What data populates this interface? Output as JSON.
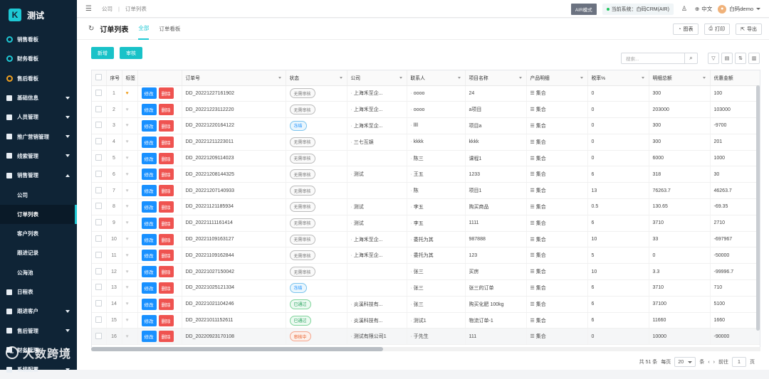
{
  "brand": {
    "logo": "K",
    "name": "测试"
  },
  "sidebar": {
    "items": [
      {
        "label": "销售看板",
        "icon": "ring-icon",
        "color": "teal",
        "arrow": ""
      },
      {
        "label": "财务看板",
        "icon": "ring-icon",
        "color": "teal",
        "arrow": ""
      },
      {
        "label": "售后看板",
        "icon": "ring-icon",
        "color": "orange",
        "arrow": ""
      },
      {
        "label": "基础信息",
        "icon": "grid-icon",
        "arrow": "down"
      },
      {
        "label": "人员管理",
        "icon": "person-icon",
        "arrow": "down"
      },
      {
        "label": "推广营销管理",
        "icon": "megaphone-icon",
        "arrow": "down"
      },
      {
        "label": "线索管理",
        "icon": "clue-icon",
        "arrow": "down"
      },
      {
        "label": "销售管理",
        "icon": "sales-icon",
        "arrow": "up"
      }
    ],
    "sub_items": [
      {
        "label": "公司",
        "active": false
      },
      {
        "label": "订单列表",
        "active": true
      },
      {
        "label": "客户列表",
        "active": false
      },
      {
        "label": "跟进记录",
        "active": false
      },
      {
        "label": "公海池",
        "active": false
      }
    ],
    "bottom_items": [
      {
        "label": "日程表",
        "icon": "calendar-icon",
        "arrow": ""
      },
      {
        "label": "跟进客户",
        "icon": "follow-icon",
        "arrow": "down"
      },
      {
        "label": "售后管理",
        "icon": "service-icon",
        "arrow": "down"
      },
      {
        "label": "财务管理",
        "icon": "finance-icon",
        "arrow": "down"
      },
      {
        "label": "系统配置",
        "icon": "settings-icon",
        "arrow": "down"
      }
    ]
  },
  "topbar": {
    "breadcrumb": [
      "公司",
      "订单列表"
    ],
    "air_mode": "AIR模式",
    "current_system": "当前系统：白码CRM(AIR)",
    "language": "中文",
    "user": "白码demo"
  },
  "page": {
    "title": "订单列表",
    "tabs": [
      {
        "label": "全部",
        "active": true
      },
      {
        "label": "订单看板",
        "active": false
      }
    ],
    "actions": [
      {
        "label": "图表",
        "icon": "chart-icon"
      },
      {
        "label": "打印",
        "icon": "print-icon"
      },
      {
        "label": "导出",
        "icon": "export-icon"
      }
    ]
  },
  "toolbar": {
    "new_label": "新增",
    "audit_label": "审核",
    "search_placeholder": "搜索..."
  },
  "table": {
    "columns": [
      "序号",
      "标签",
      "",
      "订单号",
      "状态",
      "公司",
      "联系人",
      "项目名称",
      "产品明细",
      "税率%",
      "明细总额",
      "优惠金额"
    ],
    "edit_label": "修改",
    "delete_label": "删除",
    "product_text": "集合",
    "rows": [
      {
        "seq": "1",
        "tag": true,
        "order": "DD_20221227161902",
        "status": "无需审核",
        "status_type": "gray",
        "company": "上海禾至企...",
        "contact": "oooo",
        "project": "24",
        "tax": "0",
        "total": "300",
        "discount": "100"
      },
      {
        "seq": "2",
        "tag": false,
        "order": "DD_20221223112220",
        "status": "无需审核",
        "status_type": "gray",
        "company": "上海禾至企...",
        "contact": "oooo",
        "project": "a项目",
        "tax": "0",
        "total": "203000",
        "discount": "103000"
      },
      {
        "seq": "3",
        "tag": false,
        "order": "DD_20221220164122",
        "status": "冻结",
        "status_type": "blue",
        "company": "上海禾至企...",
        "contact": "llll",
        "project": "项目a",
        "tax": "0",
        "total": "300",
        "discount": "-9700"
      },
      {
        "seq": "4",
        "tag": false,
        "order": "DD_20221211223011",
        "status": "无需审核",
        "status_type": "gray",
        "company": "三七互娱",
        "contact": "kkkk",
        "project": "kkkk",
        "tax": "0",
        "total": "300",
        "discount": "201"
      },
      {
        "seq": "5",
        "tag": false,
        "order": "DD_20221209114023",
        "status": "无需审核",
        "status_type": "gray",
        "company": "",
        "contact": "陈三",
        "project": "课程1",
        "tax": "0",
        "total": "6000",
        "discount": "1000"
      },
      {
        "seq": "6",
        "tag": false,
        "order": "DD_20221208144325",
        "status": "无需审核",
        "status_type": "gray",
        "company": "测试",
        "contact": "王五",
        "project": "1233",
        "tax": "6",
        "total": "318",
        "discount": "30"
      },
      {
        "seq": "7",
        "tag": false,
        "order": "DD_20221207140933",
        "status": "无需审核",
        "status_type": "gray",
        "company": "",
        "contact": "陈",
        "project": "项目1",
        "tax": "13",
        "total": "76263.7",
        "discount": "46263.7"
      },
      {
        "seq": "8",
        "tag": false,
        "order": "DD_20221121185934",
        "status": "无需审核",
        "status_type": "gray",
        "company": "测试",
        "contact": "李五",
        "project": "购买商品",
        "tax": "0.5",
        "total": "130.65",
        "discount": "-69.35"
      },
      {
        "seq": "9",
        "tag": false,
        "order": "DD_20221111161414",
        "status": "无需审核",
        "status_type": "gray",
        "company": "测试",
        "contact": "李五",
        "project": "1111",
        "tax": "6",
        "total": "3710",
        "discount": "2710"
      },
      {
        "seq": "10",
        "tag": false,
        "order": "DD_20221109163127",
        "status": "无需审核",
        "status_type": "gray",
        "company": "上海禾至企...",
        "contact": "委托为其",
        "project": "987888",
        "tax": "10",
        "total": "33",
        "discount": "-697967"
      },
      {
        "seq": "11",
        "tag": false,
        "order": "DD_20221109162844",
        "status": "无需审核",
        "status_type": "gray",
        "company": "上海禾至企...",
        "contact": "委托为其",
        "project": "123",
        "tax": "5",
        "total": "0",
        "discount": "-50000"
      },
      {
        "seq": "12",
        "tag": false,
        "order": "DD_20221027150042",
        "status": "无需审核",
        "status_type": "gray",
        "company": "",
        "contact": "张三",
        "project": "买房",
        "tax": "10",
        "total": "3.3",
        "discount": "-99996.7"
      },
      {
        "seq": "13",
        "tag": false,
        "order": "DD_20221025121334",
        "status": "冻结",
        "status_type": "blue",
        "company": "",
        "contact": "张三",
        "project": "张三的订单",
        "tax": "6",
        "total": "3710",
        "discount": "710"
      },
      {
        "seq": "14",
        "tag": false,
        "order": "DD_20221021104246",
        "status": "已通过",
        "status_type": "green",
        "company": "炎溪科技有...",
        "contact": "张三",
        "project": "购买化肥 100kg",
        "tax": "6",
        "total": "37100",
        "discount": "5100"
      },
      {
        "seq": "15",
        "tag": false,
        "order": "DD_20221011152611",
        "status": "已通过",
        "status_type": "green",
        "company": "炎溪科技有...",
        "contact": "测试1",
        "project": "物流订单-1",
        "tax": "6",
        "total": "11660",
        "discount": "1660"
      },
      {
        "seq": "16",
        "tag": false,
        "order": "DD_20220923170108",
        "status": "审核中",
        "status_type": "orange",
        "company": "测试有限公司1",
        "contact": "于先生",
        "project": "111",
        "tax": "0",
        "total": "10000",
        "discount": "-90000"
      }
    ]
  },
  "pager": {
    "total": "共 51 条",
    "per_page_label": "每页",
    "per_page": "20",
    "unit": "条",
    "goto": "前往",
    "page": "1",
    "page_unit": "页"
  },
  "watermark": "大数跨境"
}
